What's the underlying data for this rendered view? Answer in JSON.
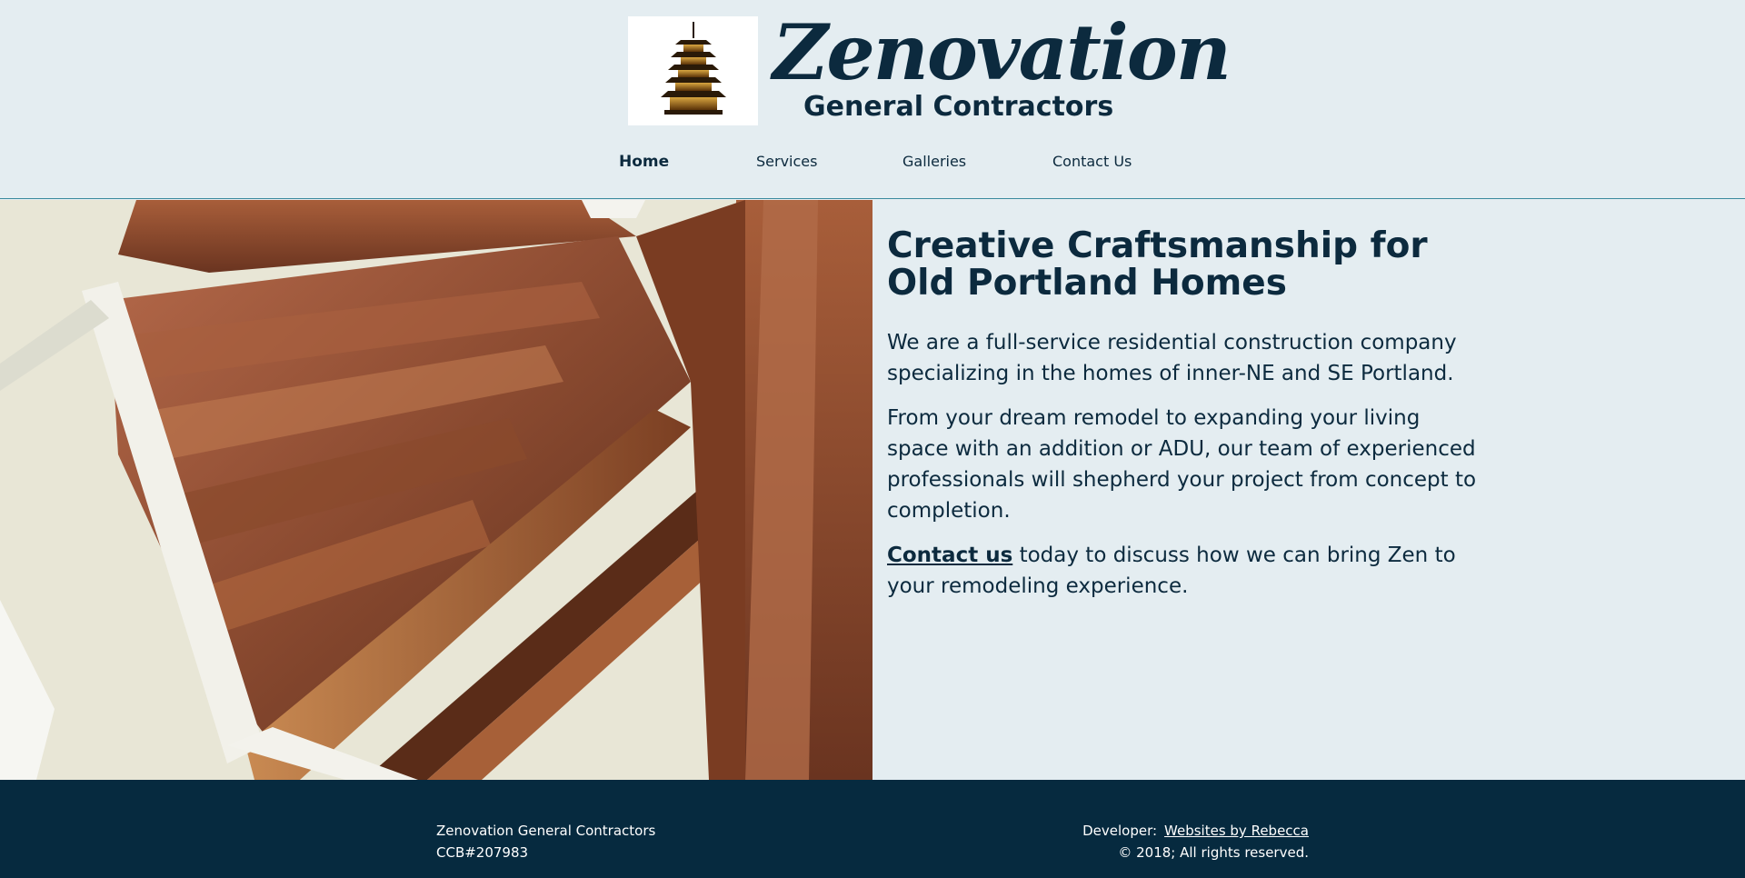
{
  "header": {
    "brand_name": "Zenovation",
    "brand_sub": "General Contractors",
    "logo_icon": "pagoda-icon"
  },
  "nav": {
    "items": [
      {
        "label": "Home",
        "active": true
      },
      {
        "label": "Services",
        "active": false
      },
      {
        "label": "Galleries",
        "active": false
      },
      {
        "label": "Contact Us",
        "active": false
      }
    ]
  },
  "main": {
    "headline": "Creative Craftsmanship for Old Portland Homes",
    "para1": "We are a full-service residential construction company specializing in the homes of inner-NE and SE Portland.",
    "para2": "From your dream remodel to expanding your living space with an addition or ADU, our team of experienced professionals will shepherd your project from concept to completion.",
    "para3_link": "Contact us",
    "para3_rest": " today to discuss how we can bring Zen to your remodeling experience."
  },
  "footer": {
    "company": "Zenovation General Contractors",
    "license": "CCB#207983",
    "developer_label": "Developer:",
    "developer_link": "Websites by Rebecca",
    "copyright": "© 2018; All rights reserved."
  },
  "colors": {
    "background": "#e4edf1",
    "text": "#0c2a3e",
    "footer": "#062a3f"
  }
}
